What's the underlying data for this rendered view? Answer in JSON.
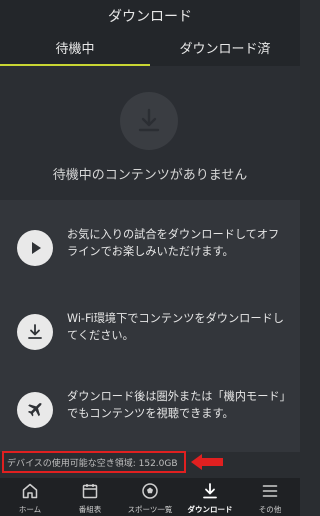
{
  "header": {
    "title": "ダウンロード",
    "tabs": [
      {
        "label": "待機中",
        "active": true
      },
      {
        "label": "ダウンロード済",
        "active": false
      }
    ]
  },
  "empty_state": {
    "icon": "download-icon",
    "message": "待機中のコンテンツがありません"
  },
  "info": [
    {
      "icon": "play-icon",
      "text": "お気に入りの試合をダウンロードしてオフラインでお楽しみいただけます。"
    },
    {
      "icon": "download-icon",
      "text": "Wi-Fi環境下でコンテンツをダウンロードしてください。"
    },
    {
      "icon": "airplane-icon",
      "text": "ダウンロード後は圏外または「機内モード」でもコンテンツを視聴できます。"
    }
  ],
  "storage": {
    "text": "デバイスの使用可能な空き領域: 152.0GB"
  },
  "colors": {
    "accent": "#c8d533",
    "highlight_box": "#e02020"
  },
  "bottom_nav": [
    {
      "icon": "home-icon",
      "label": "ホーム",
      "active": false
    },
    {
      "icon": "calendar-icon",
      "label": "番組表",
      "active": false
    },
    {
      "icon": "soccer-ball-icon",
      "label": "スポーツ一覧",
      "active": false
    },
    {
      "icon": "download-icon",
      "label": "ダウンロード",
      "active": true
    },
    {
      "icon": "menu-icon",
      "label": "その他",
      "active": false
    }
  ]
}
